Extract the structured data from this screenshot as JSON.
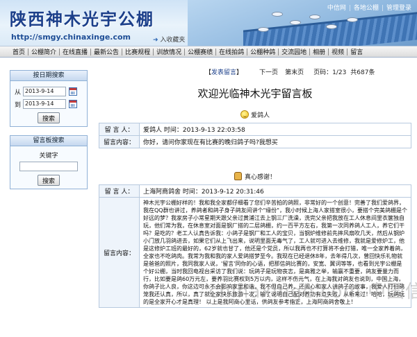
{
  "header": {
    "site_title": "陕西神木光宇公棚",
    "site_url": "http://smgy.chinaxinge.com",
    "fav_link": "入收藏夹",
    "top_links": [
      "中信网",
      "各地公棚",
      "管理登录"
    ]
  },
  "nav": {
    "items": [
      "首页",
      "公棚简介",
      "在线直播",
      "最新公告",
      "比赛规程",
      "训放情况",
      "公棚赛绩",
      "在线拍鸽",
      "公棚种鸽",
      "交流园地",
      "相册",
      "视频",
      "留言"
    ]
  },
  "sidebar": {
    "date_box": {
      "title": "按日期搜索",
      "from_label": "从",
      "from_value": "2013-9-14",
      "to_label": "到",
      "to_value": "2013-9-14",
      "search_button": "搜索"
    },
    "keyword_box": {
      "title": "留言板搜索",
      "keyword_label": "关键字",
      "keyword_value": "",
      "search_button": "搜索"
    }
  },
  "main": {
    "pager": {
      "post_link": "发表留言",
      "prev": "下一页",
      "last": "第末页",
      "page_info": "页码：1/23",
      "total": "共687条"
    },
    "heading": "欢迎光临神木光宇留言板",
    "messages": [
      {
        "display_name": "爱鸽人",
        "author_label": "留 言 人：",
        "author": "爱鸽人",
        "time": "时间：2013-9-13 22:03:58",
        "content_label": "留言内容：",
        "content": "你好，请问你家现在有比赛的晚归鸽子吗?我想买"
      },
      {
        "display_name": "真心感谢！",
        "author_label": "留 言 人：",
        "author": "上海阿商鸽舍",
        "time": "时间：2013-9-12 20:31:46",
        "content_label": "留言内容：",
        "content": "神木光宇公棚好样的！我和我全家都仔细看了您们辛苦拍的鸽照，非常好的一个创意！完善了我们爱鸽界，我在QQ群也讲过，养鸽者和鸽子身子鸽友间讲个\"缘份\"，我小时候上海人家搭室很小，要搭个完美鸽棚是个好远的梦？我家房子小常星期天跟父亲过黄浦江去上钢三厂洗澡，洗完父亲把我放在工人休息间里衣箧独自玩，他们常为我，在休息室对面是钢厂搭的二层鸽棚，约一百平方左右，我第一次同养鸽人工人，养它们干吗？是吃的？老工人认真告诉我：小鸽子是钢厂和工人的宝贝，当钢炉维修前先摔风扇吹几天，然后从钢炉小门放几羽鸽进去，如果它们从上飞出来，说明里面无毒气了，工人就可进入去维修，我就是爱修炉工，他是这修炉工班的最好的，62岁就也甘了，他还是个党员，所以我再也不打算将不会打猎，唯一全家养着鸽，全家也不吃鸽肉。我常为我和我的家人爱鸽搭梦至今。我现在已经退休8年，去年得几次，曾回快乐礼物就是爸爸的照片，我同我家人说，'留言'同你的心语，把那信鸽比赛的，安宽、翼词等等，也看到光宇公棚是个好公棚，当时我回电视台采访了我们说：玩鸽子是玩物丧志，是高雅之举，输赢不重要，鸽友要量力而行，比如要是鸽60万元左，要养羽比赛权到5万以内，这样不伤元气，在上海我对鸽友也说到，中国上海，你鸽子比人良，你这边可永不会影响家里和谐，我不但自己养，还闹心和家人讲鸽子的故事，我爱人打扫鸽笼我还认真，所以，真了就全家快乐旅游一次，输了说明自己配对养功有点失败，从新来过！哈哈，玩鸽玩的是全家开心才是真理！ 以上是我阿商心里话，供鸽友参考指正，上海阿商鸽舍敬上！"
      }
    ]
  },
  "watermark": "chinaxinge.com 中国信鸽信息网"
}
